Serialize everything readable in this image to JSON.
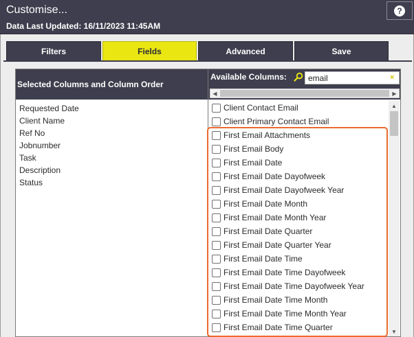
{
  "header": {
    "title": "Customise...",
    "subtitle": "Data Last Updated: 16/11/2023 11:45AM",
    "help_label": "?"
  },
  "tabs": [
    {
      "label": "Filters",
      "active": false
    },
    {
      "label": "Fields",
      "active": true
    },
    {
      "label": "Advanced",
      "active": false
    },
    {
      "label": "Save",
      "active": false
    }
  ],
  "left_panel": {
    "heading": "Selected Columns and Column Order",
    "items": [
      "Requested Date",
      "Client Name",
      "Ref No",
      "Jobnumber",
      "Task",
      "Description",
      "Status"
    ]
  },
  "right_panel": {
    "heading": "Available Columns:",
    "search_value": "email",
    "clear_label": "×",
    "items": [
      "Client Contact Email",
      "Client Primary Contact Email",
      "First Email Attachments",
      "First Email Body",
      "First Email Date",
      "First Email Date Dayofweek",
      "First Email Date Dayofweek Year",
      "First Email Date Month",
      "First Email Date Month Year",
      "First Email Date Quarter",
      "First Email Date Quarter Year",
      "First Email Date Time",
      "First Email Date Time Dayofweek",
      "First Email Date Time Dayofweek Year",
      "First Email Date Time Month",
      "First Email Date Time Month Year",
      "First Email Date Time Quarter"
    ]
  },
  "colors": {
    "header_bg": "#3e3e4e",
    "active_tab": "#e9e612",
    "highlight": "#ec6a2d"
  }
}
